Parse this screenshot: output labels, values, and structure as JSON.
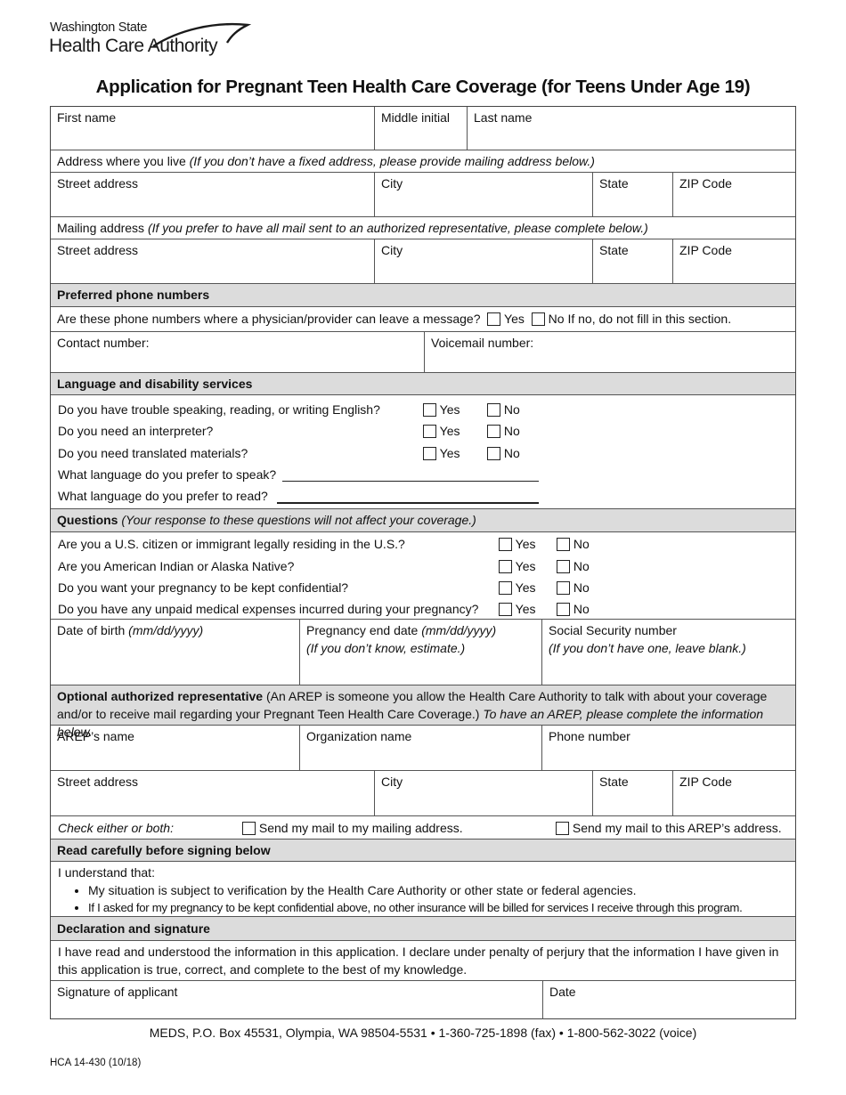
{
  "logo": {
    "line1": "Washington State",
    "line2": "Health Care Authority"
  },
  "title": "Application for Pregnant Teen Health Care Coverage (for Teens Under Age 19)",
  "name_row": {
    "first": "First name",
    "middle": "Middle initial",
    "last": "Last name"
  },
  "home_address": {
    "heading": "Address where you live ",
    "heading_note": "(If you don’t have a fixed address, please provide mailing address below.)",
    "street": "Street address",
    "city": "City",
    "state": "State",
    "zip": "ZIP Code"
  },
  "mailing_address": {
    "heading": "Mailing address ",
    "heading_note": "(If you prefer to have all mail sent to an authorized representative, please complete below.)",
    "street": "Street address",
    "city": "City",
    "state": "State",
    "zip": "ZIP Code"
  },
  "phones": {
    "heading": "Preferred phone numbers",
    "question": "Are these phone numbers where a physician/provider can leave a message?",
    "yes": "Yes",
    "no": "No If no, do not fill in this section.",
    "contact": "Contact number:",
    "voicemail": "Voicemail number:"
  },
  "language": {
    "heading": "Language and disability services",
    "questions": [
      {
        "q": "Do you have trouble speaking, reading, or writing English?",
        "yes": "Yes",
        "no": "No"
      },
      {
        "q": "Do you need an interpreter?",
        "yes": "Yes",
        "no": "No"
      },
      {
        "q": "Do you need translated materials?",
        "yes": "Yes",
        "no": "No"
      }
    ],
    "speak": "What language do you prefer to speak?",
    "read": "What language do you prefer to read?"
  },
  "questions": {
    "heading": "Questions",
    "heading_note": " (Your response to these questions will not affect your coverage.)",
    "items": [
      {
        "q": "Are you a U.S. citizen or immigrant legally residing in the U.S.?",
        "yes": "Yes",
        "no": "No"
      },
      {
        "q": "Are you American Indian or Alaska Native?",
        "yes": "Yes",
        "no": "No"
      },
      {
        "q": "Do you want your pregnancy to be kept confidential?",
        "yes": "Yes",
        "no": "No"
      },
      {
        "q": "Do you have any unpaid medical expenses incurred during your pregnancy?",
        "yes": "Yes",
        "no": "No"
      }
    ],
    "dob": "Date of birth ",
    "dob_fmt": "(mm/dd/yyyy)",
    "preg_end": "Pregnancy end date ",
    "preg_end_fmt": "(mm/dd/yyyy)",
    "preg_end_note": "(If you don’t know, estimate.)",
    "ssn": "Social Security number",
    "ssn_note": "(If you don’t have one, leave blank.)"
  },
  "arep": {
    "heading": "Optional authorized representative",
    "heading_text": " (An AREP is someone you allow the Health Care Authority to talk with about your coverage and/or to receive mail regarding your Pregnant Teen Health Care Coverage.) ",
    "heading_note": "To have an AREP, please complete the information below.",
    "name": "AREP’s name",
    "org": "Organization name",
    "phone": "Phone number",
    "street": "Street address",
    "city": "City",
    "state": "State",
    "zip": "ZIP Code",
    "check_label": "Check either or both:",
    "opt_mailing": "Send my mail to my mailing address.",
    "opt_arep": "Send my mail to this AREP’s address."
  },
  "read_carefully": {
    "heading": "Read carefully before signing below",
    "intro": "I understand that:",
    "bullets": [
      "My situation is subject to verification by the Health Care Authority or other state or federal agencies.",
      "If I asked for my pregnancy to be kept confidential above, no other insurance will be billed for services I receive through this program."
    ]
  },
  "declaration": {
    "heading": "Declaration and signature",
    "text": "I have read and understood the information in this application. I declare under penalty of perjury that the information I have given in this application is true, correct, and complete to the best of my knowledge.",
    "signature": "Signature of applicant",
    "date": "Date"
  },
  "footer": {
    "contact": "MEDS, P.O. Box 45531, Olympia, WA 98504-5531 • 1-360-725-1898 (fax) • 1-800-562-3022 (voice)",
    "form_number": "HCA 14-430 (10/18)"
  }
}
